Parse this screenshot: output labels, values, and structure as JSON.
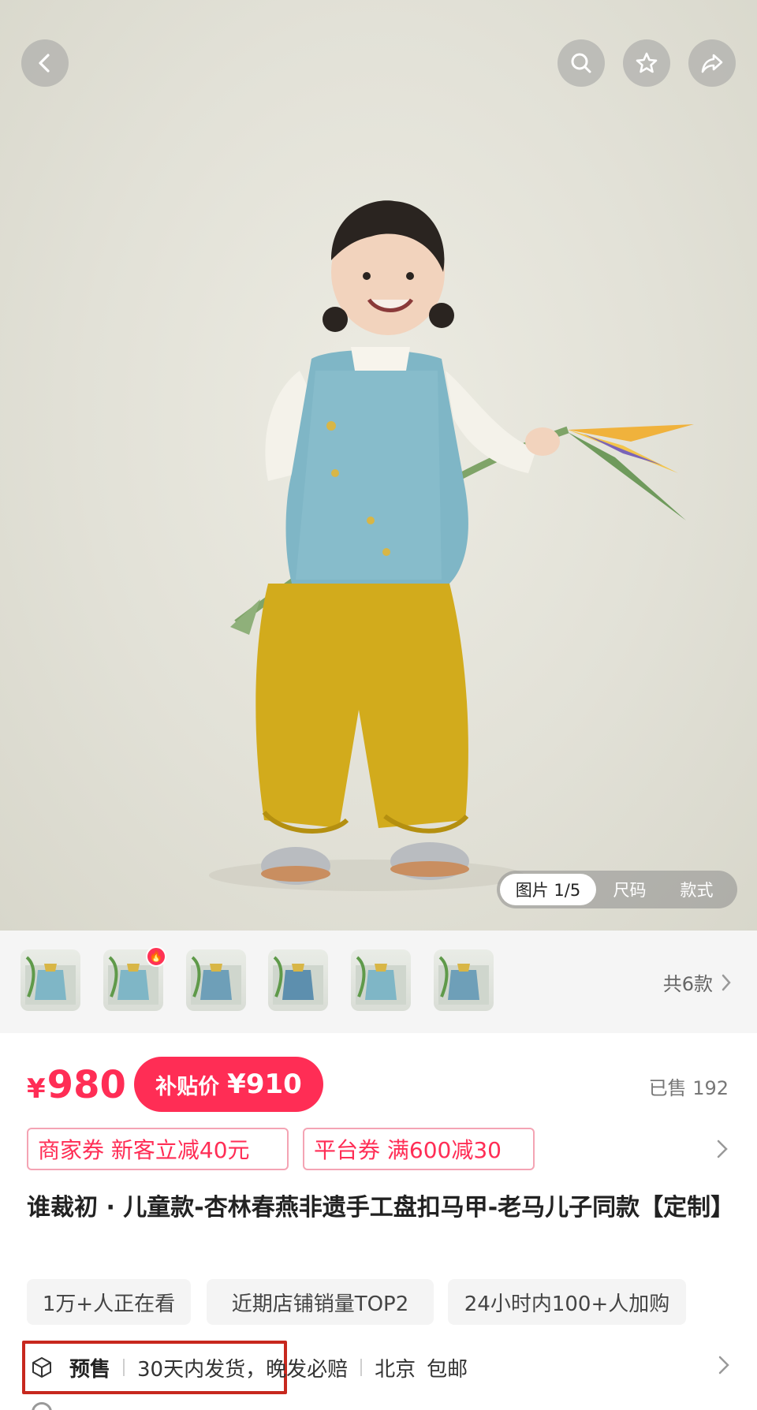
{
  "header": {
    "back_icon": "chevron-left-icon",
    "search_icon": "search-icon",
    "favorite_icon": "star-icon",
    "share_icon": "share-arrow-icon"
  },
  "media_tabs": [
    {
      "label": "图片 1/5",
      "active": true
    },
    {
      "label": "尺码",
      "active": false
    },
    {
      "label": "款式",
      "active": false
    }
  ],
  "thumbnails": {
    "count_label": "共6款",
    "hot_badge_icon": "flame-icon"
  },
  "price": {
    "currency": "¥",
    "amount": "980",
    "subsidy_label": "补贴价",
    "subsidy_price": "¥910",
    "sold_label": "已售 192"
  },
  "coupons": [
    {
      "label": "商家券 新客立减40元"
    },
    {
      "label": "平台券 满600减30"
    }
  ],
  "product": {
    "title": "谁裁初 · 儿童款-杏林春燕非遗手工盘扣马甲-老马儿子同款【定制】"
  },
  "tags": [
    {
      "label": "1万+人正在看"
    },
    {
      "label": "近期店铺销量TOP2"
    },
    {
      "label": "24小时内100+人加购"
    }
  ],
  "shipping": {
    "icon": "package-icon",
    "presale": "预售",
    "delivery": "30天内发货，",
    "guarantee": "晚发必赔",
    "location": "北京",
    "postage": "包邮"
  },
  "colors": {
    "accent": "#ff2d55",
    "highlight_box": "#c7281e"
  }
}
